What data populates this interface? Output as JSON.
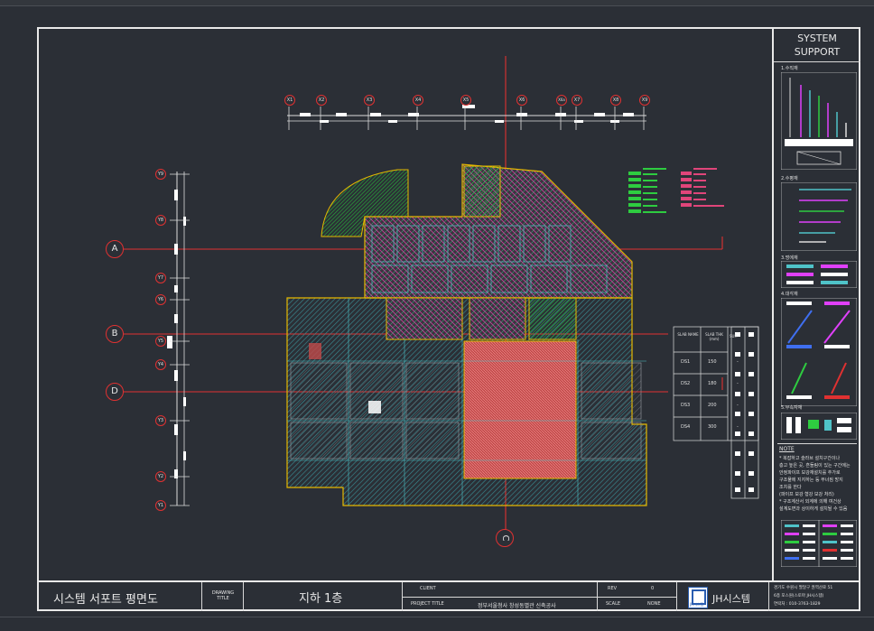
{
  "drawing": {
    "title": "시스템 서포트 평면도",
    "drawing_title_label": "DRAWING\nTITLE",
    "floor_name": "지하 1층",
    "client_label": "CLIENT",
    "client_value": "",
    "project_title_label": "PROJECT TITLE",
    "project_title_value": "정부서울청사 창성동별관 신축공사",
    "rev_label": "REV",
    "rev_value": "0",
    "scale_label": "SCALE",
    "scale_value": "NONE",
    "company_name": "JH시스템",
    "logo_text": "JH시스템"
  },
  "side_panel": {
    "title_line1": "SYSTEM",
    "title_line2": "SUPPORT",
    "sections": [
      "1.수직재",
      "2.수평재",
      "3.멍에재",
      "4.대각재",
      "5.부속자재"
    ],
    "note_heading": "NOTE",
    "note_lines": [
      "* 복잡하고 슬라브 설치구간이나",
      "  층고 높은 곳, 흔들림이 있는 구간에는",
      "  안정파이프 보강재설치를 추가로",
      "  구조물에 지지하는 등 무너짐 방지",
      "  조치를 한다",
      "  (파이프 보강 형강 보강 처리)",
      "* 구조계산서 외계에 의해 여건상",
      "  설계도면과 상이하게 설치될 수 있음"
    ],
    "address_lines": [
      "경기도 수원시 팔달구 권역산로 51",
      "6층 포스원(스토마 JH시스템)",
      "연락처 : 010-3763-1829"
    ]
  },
  "grid": {
    "top_axis_labels": [
      "X1",
      "X2",
      "X3",
      "X4",
      "X5",
      "X6",
      "X6a",
      "X7",
      "X8",
      "X9"
    ],
    "left_axis_labels": [
      "Y9",
      "Y8",
      "Y7",
      "Y6",
      "Y5",
      "Y4",
      "Y3",
      "Y2",
      "Y1"
    ],
    "section_markers": [
      "A",
      "B",
      "D",
      "C"
    ]
  },
  "legend_table": {
    "headers": [
      "SLAB NAME",
      "SLAB THK (mm)",
      "SUP."
    ],
    "rows": [
      [
        "DS1",
        "150",
        "-"
      ],
      [
        "DS2",
        "180",
        "-"
      ],
      [
        "DS3",
        "200",
        "-"
      ],
      [
        "DS4",
        "300",
        "-"
      ]
    ]
  },
  "colors": {
    "background": "#2b2f36",
    "frame": "#e9e9e9",
    "grid_line": "#e03131",
    "building_outline": "#e6b800",
    "hatch_cyan": "#4fc3c8",
    "hatch_green": "#2ecc40",
    "hatch_red": "#e05a5a",
    "hatch_magenta": "#e040fb"
  }
}
